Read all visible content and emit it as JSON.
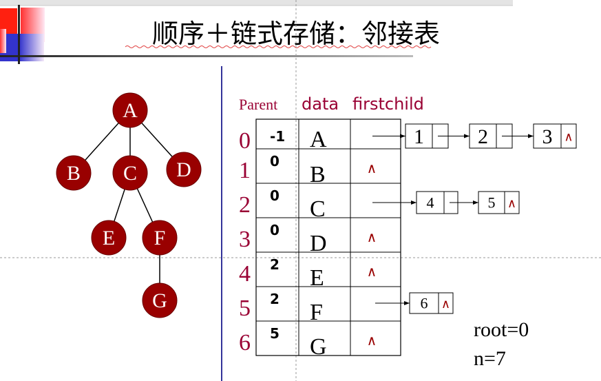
{
  "slide": {
    "title": "顺序＋链式存储：邻接表",
    "colors": {
      "accent": "#990033",
      "node_fill": "#990000",
      "divider": "#333399"
    }
  },
  "tree": {
    "nodes": [
      "A",
      "B",
      "C",
      "D",
      "E",
      "F",
      "G"
    ],
    "edges": [
      [
        "A",
        "B"
      ],
      [
        "A",
        "C"
      ],
      [
        "A",
        "D"
      ],
      [
        "C",
        "E"
      ],
      [
        "C",
        "F"
      ],
      [
        "F",
        "G"
      ]
    ]
  },
  "table": {
    "headers": {
      "parent": "Parent",
      "data": "data",
      "firstchild": "firstchild"
    },
    "rows": [
      {
        "index": "0",
        "parent": "-1",
        "data": "A",
        "firstchild": ""
      },
      {
        "index": "1",
        "parent": "0",
        "data": "B",
        "firstchild": "∧"
      },
      {
        "index": "2",
        "parent": "0",
        "data": "C",
        "firstchild": ""
      },
      {
        "index": "3",
        "parent": "0",
        "data": "D",
        "firstchild": "∧"
      },
      {
        "index": "4",
        "parent": "2",
        "data": "E",
        "firstchild": "∧"
      },
      {
        "index": "5",
        "parent": "2",
        "data": "F",
        "firstchild": ""
      },
      {
        "index": "6",
        "parent": "5",
        "data": "G",
        "firstchild": "∧"
      }
    ]
  },
  "child_lists": {
    "row0": [
      {
        "value": "1",
        "next": ""
      },
      {
        "value": "2",
        "next": ""
      },
      {
        "value": "3",
        "next": "∧"
      }
    ],
    "row2": [
      {
        "value": "4",
        "next": ""
      },
      {
        "value": "5",
        "next": "∧"
      }
    ],
    "row5": [
      {
        "value": "6",
        "next": "∧"
      }
    ]
  },
  "info": {
    "root": "root=0",
    "n": "n=7"
  }
}
